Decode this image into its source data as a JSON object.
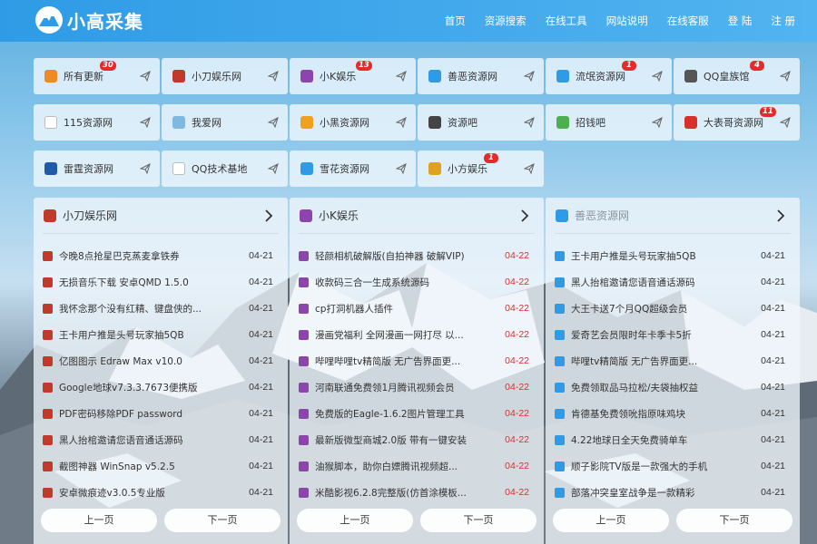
{
  "brand": {
    "name": "小高采集"
  },
  "nav": [
    "首页",
    "资源搜索",
    "在线工具",
    "网站说明",
    "在线客服",
    "登 陆",
    "注 册"
  ],
  "tiles": [
    {
      "label": "所有更新",
      "badge": "30",
      "icon": "grid-icon",
      "color": "#f08a24"
    },
    {
      "label": "小刀娱乐网",
      "badge": "",
      "icon": "xiaodao-icon",
      "color": "#c0392b"
    },
    {
      "label": "小K娱乐",
      "badge": "13",
      "icon": "k-letter-icon",
      "color": "#8e44ad"
    },
    {
      "label": "善恶资源网",
      "badge": "",
      "icon": "shane-icon",
      "color": "#2f9be6"
    },
    {
      "label": "流氓资源网",
      "badge": "1",
      "icon": "globe-icon",
      "color": "#2f9be6"
    },
    {
      "label": "QQ皇族馆",
      "badge": "4",
      "icon": "crown-icon",
      "color": "#555555"
    },
    {
      "label": "115资源网",
      "badge": "",
      "icon": "blank-icon",
      "color": "#ffffff"
    },
    {
      "label": "我爱网",
      "badge": "",
      "icon": "heart-globe-icon",
      "color": "#7fb8e0"
    },
    {
      "label": "小黑资源网",
      "badge": "",
      "icon": "check-badge-icon",
      "color": "#f0a020"
    },
    {
      "label": "资源吧",
      "badge": "",
      "icon": "box-icon",
      "color": "#444444"
    },
    {
      "label": "招钱吧",
      "badge": "",
      "icon": "phone-icon",
      "color": "#4caf50"
    },
    {
      "label": "大表哥资源网",
      "badge": "11",
      "icon": "seal-icon",
      "color": "#d9302c"
    },
    {
      "label": "雷霆资源网",
      "badge": "",
      "icon": "bird-icon",
      "color": "#1f5aa8"
    },
    {
      "label": "QQ技术基地",
      "badge": "",
      "icon": "blank-icon",
      "color": "#ffffff"
    },
    {
      "label": "雪花资源网",
      "badge": "",
      "icon": "snowflake-icon",
      "color": "#2f9be6"
    },
    {
      "label": "小方娱乐",
      "badge": "1",
      "icon": "cube-icon",
      "color": "#e0a020"
    }
  ],
  "panels": [
    {
      "title": "小刀娱乐网",
      "icon": "xiaodao-icon",
      "color": "#c0392b",
      "title_color": "#333333",
      "date_red": false,
      "items": [
        {
          "title": "今晚8点抢星巴克蒸麦拿铁券",
          "date": "04-21"
        },
        {
          "title": "无损音乐下载 安卓QMD 1.5.0",
          "date": "04-21"
        },
        {
          "title": "我怀念那个没有红精、键盘侠的...",
          "date": "04-21"
        },
        {
          "title": "王卡用户推是头号玩家抽5QB",
          "date": "04-21"
        },
        {
          "title": "亿图图示 Edraw Max v10.0",
          "date": "04-21"
        },
        {
          "title": "Google地球v7.3.3.7673便携版",
          "date": "04-21"
        },
        {
          "title": "PDF密码移除PDF password",
          "date": "04-21"
        },
        {
          "title": "黑人抬棺邀请您语音通话源码",
          "date": "04-21"
        },
        {
          "title": "截图神器 WinSnap v5.2.5",
          "date": "04-21"
        },
        {
          "title": "安卓微痕迹v3.0.5专业版",
          "date": "04-21"
        }
      ]
    },
    {
      "title": "小K娱乐",
      "icon": "k-letter-icon",
      "color": "#8e44ad",
      "title_color": "#333333",
      "date_red": true,
      "items": [
        {
          "title": "轻颜相机破解版(自拍神器 破解VIP)",
          "date": "04-22"
        },
        {
          "title": "收款码三合一生成系统源码",
          "date": "04-22"
        },
        {
          "title": "cp打洞机器人插件",
          "date": "04-22"
        },
        {
          "title": "漫画党福利 全网漫画一网打尽 以...",
          "date": "04-22"
        },
        {
          "title": "哔哩哔哩tv精简版 无广告界面更...",
          "date": "04-22"
        },
        {
          "title": "河南联通免费领1月腾讯视频会员",
          "date": "04-22"
        },
        {
          "title": "免费版的Eagle-1.6.2图片管理工具",
          "date": "04-22"
        },
        {
          "title": "最新版微型商城2.0版 带有一键安装",
          "date": "04-22"
        },
        {
          "title": "油猴脚本，助你白嫖腾讯视频超...",
          "date": "04-22"
        },
        {
          "title": "米酷影视6.2.8完整版(仿首涂模板...",
          "date": "04-22"
        }
      ]
    },
    {
      "title": "善恶资源网",
      "icon": "shane-icon",
      "color": "#2f9be6",
      "title_color": "#8a949c",
      "date_red": false,
      "items": [
        {
          "title": "王卡用户推是头号玩家抽5QB",
          "date": "04-21"
        },
        {
          "title": "黑人抬棺邀请您语音通话源码",
          "date": "04-21"
        },
        {
          "title": "大王卡送7个月QQ超级会员",
          "date": "04-21"
        },
        {
          "title": "爱奇艺会员限时年卡季卡5折",
          "date": "04-21"
        },
        {
          "title": "哔哩tv精简版 无广告界面更...",
          "date": "04-21"
        },
        {
          "title": "免费领取品马拉松/夫袋抽权益",
          "date": "04-21"
        },
        {
          "title": "肯德基免费领吮指原味鸡块",
          "date": "04-21"
        },
        {
          "title": "4.22地球日全天免费骑单车",
          "date": "04-21"
        },
        {
          "title": "顺子影院TV版是一款强大的手机",
          "date": "04-21"
        },
        {
          "title": "部落冲突皇室战争是一款精彩",
          "date": "04-21"
        }
      ]
    }
  ],
  "pager": {
    "prev": "上一页",
    "next": "下一页"
  }
}
